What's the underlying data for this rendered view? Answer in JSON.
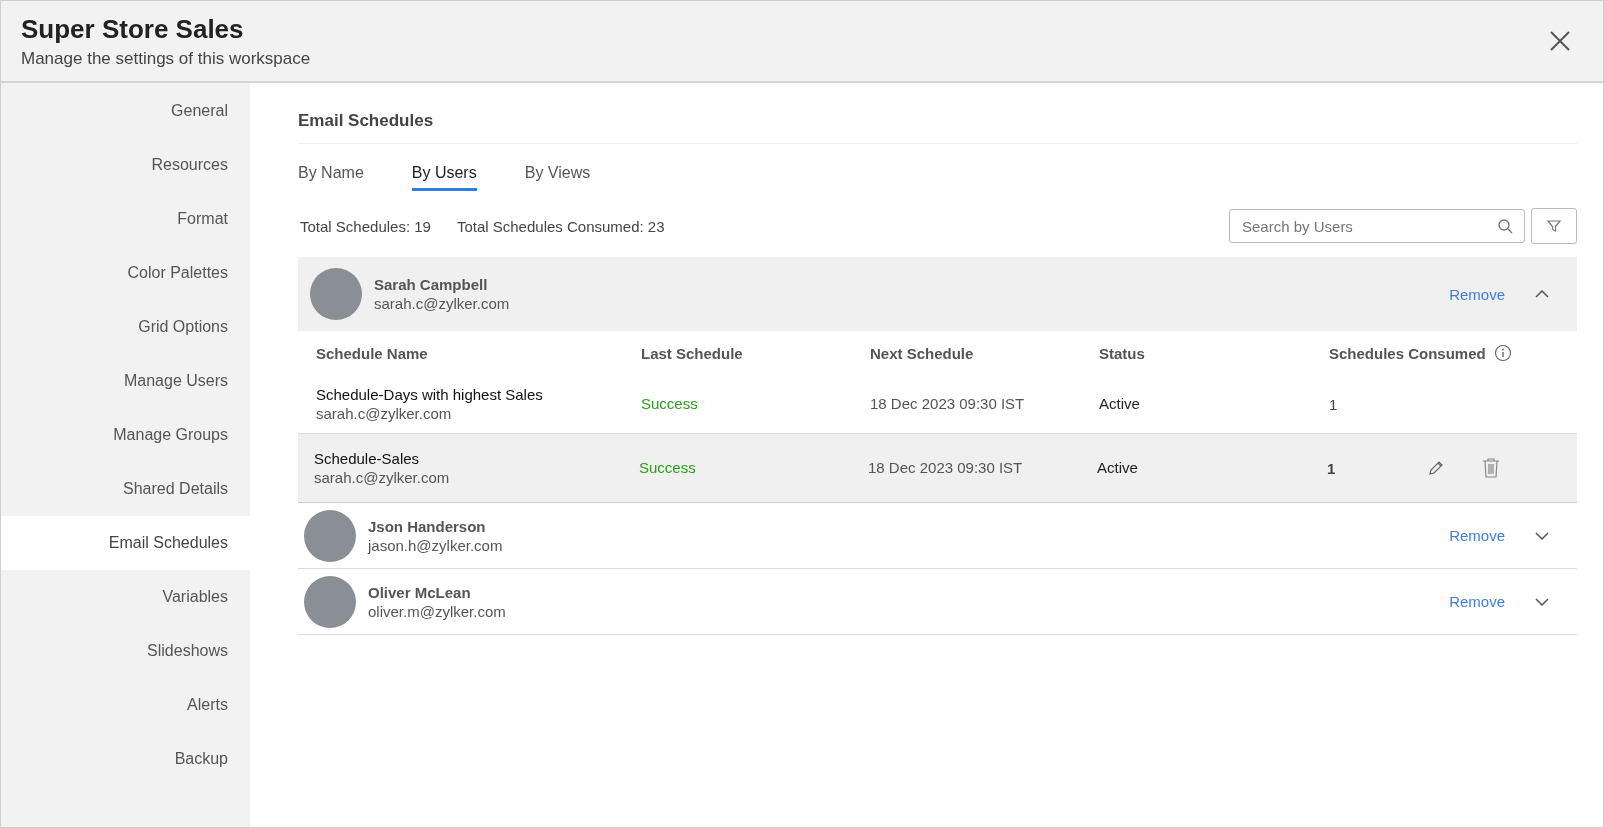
{
  "header": {
    "title": "Super Store Sales",
    "subtitle": "Manage the settings of this workspace"
  },
  "sidebar": {
    "items": [
      {
        "label": "General",
        "selected": false
      },
      {
        "label": "Resources",
        "selected": false
      },
      {
        "label": "Format",
        "selected": false
      },
      {
        "label": "Color Palettes",
        "selected": false
      },
      {
        "label": "Grid Options",
        "selected": false
      },
      {
        "label": "Manage Users",
        "selected": false
      },
      {
        "label": "Manage Groups",
        "selected": false
      },
      {
        "label": "Shared Details",
        "selected": false
      },
      {
        "label": "Email Schedules",
        "selected": true
      },
      {
        "label": "Variables",
        "selected": false
      },
      {
        "label": "Slideshows",
        "selected": false
      },
      {
        "label": "Alerts",
        "selected": false
      },
      {
        "label": "Backup",
        "selected": false
      }
    ]
  },
  "section_title": "Email Schedules",
  "tabs": [
    {
      "label": "By Name",
      "selected": false
    },
    {
      "label": "By Users",
      "selected": true
    },
    {
      "label": "By Views",
      "selected": false
    }
  ],
  "totals": [
    "Total Schedules: 19",
    "Total Schedules Consumed: 23"
  ],
  "search": {
    "placeholder": "Search by Users"
  },
  "columns": [
    "Schedule Name",
    "Last Schedule",
    "Next Schedule",
    "Status",
    "Schedules Consumed"
  ],
  "users": [
    {
      "name": "Sarah Campbell",
      "email": "sarah.c@zylker.com",
      "action": "Remove",
      "expanded": true,
      "schedules": [
        {
          "name": "Schedule-Days with highest Sales",
          "email": "sarah.c@zylker.com",
          "last": "Success",
          "next": "18 Dec 2023 09:30 IST",
          "status": "Active",
          "consumed": "1",
          "hovered": false
        },
        {
          "name": "Schedule-Sales",
          "email": "sarah.c@zylker.com",
          "last": "Success",
          "next": "18 Dec 2023 09:30 IST",
          "status": "Active",
          "consumed": "1",
          "hovered": true
        }
      ]
    },
    {
      "name": "Json Handerson",
      "email": "jason.h@zylker.com",
      "action": "Remove",
      "expanded": false
    },
    {
      "name": "Oliver McLean",
      "email": "oliver.m@zylker.com",
      "action": "Remove",
      "expanded": false
    }
  ]
}
